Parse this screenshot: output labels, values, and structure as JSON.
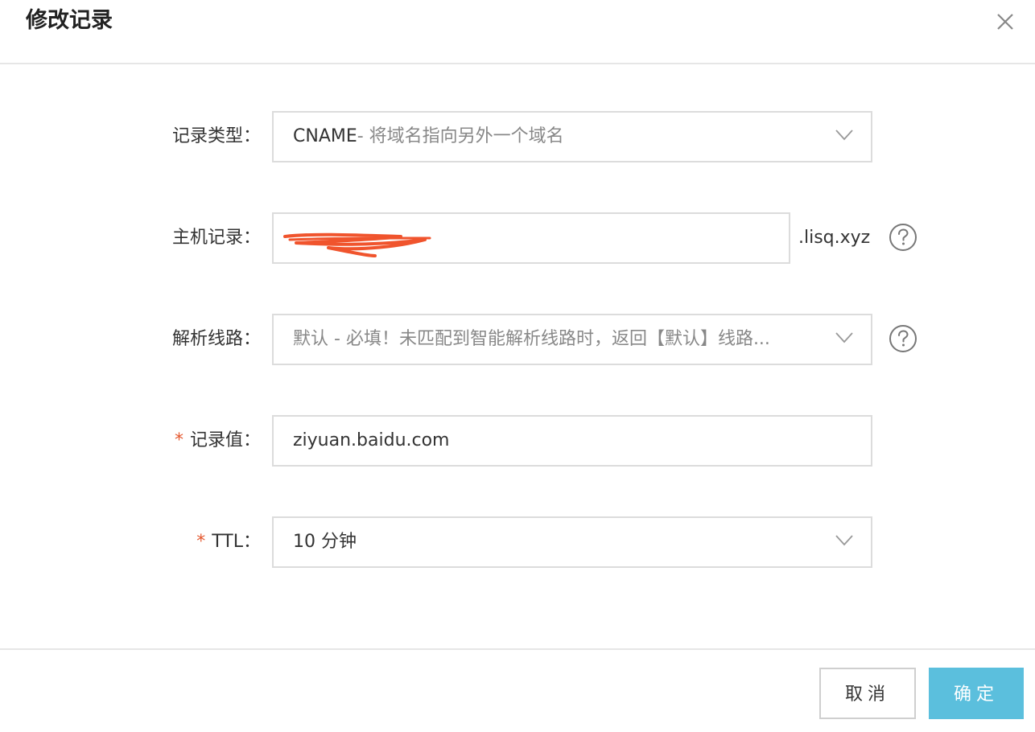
{
  "dialog": {
    "title": "修改记录",
    "close_icon": "close-icon"
  },
  "form": {
    "record_type": {
      "label": "记录类型：",
      "value_main": "CNAME",
      "value_desc": "- 将域名指向另外一个域名"
    },
    "host": {
      "label": "主机记录：",
      "suffix": ".lisq.xyz",
      "help_icon": "question-circle-icon"
    },
    "line": {
      "label": "解析线路：",
      "value_main": "默认",
      "value_desc": " - 必填！未匹配到智能解析线路时，返回【默认】线路...",
      "help_icon": "question-circle-icon"
    },
    "record_value": {
      "required_mark": "*",
      "label": "记录值：",
      "value": "ziyuan.baidu.com"
    },
    "ttl": {
      "required_mark": "*",
      "label": "TTL：",
      "value": "10 分钟"
    }
  },
  "footer": {
    "cancel_label": "取消",
    "ok_label": "确定"
  },
  "colors": {
    "accent": "#5bbfdd",
    "required": "#e4572e",
    "border": "#dcdcdc",
    "redaction": "#f0542d"
  }
}
